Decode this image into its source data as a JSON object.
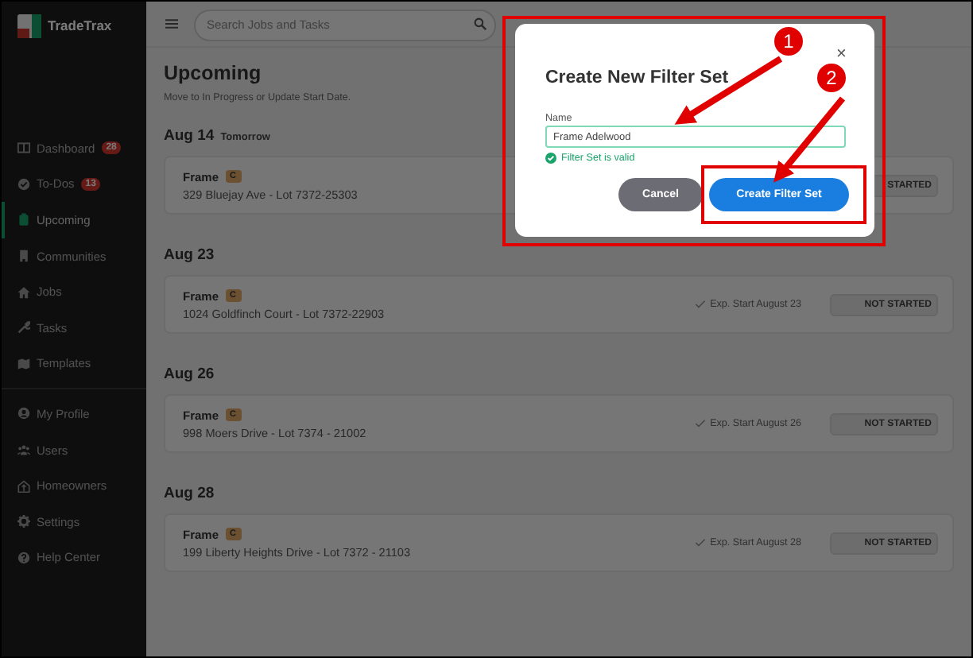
{
  "app": {
    "logo": "TradeTrax"
  },
  "sidebar": {
    "groups": [
      [
        {
          "label": "Dashboard",
          "badge": "28",
          "selected": false
        },
        {
          "label": "To-Dos",
          "badge": "13",
          "selected": false
        },
        {
          "label": "Upcoming",
          "selected": true
        },
        {
          "label": "Communities",
          "selected": false
        },
        {
          "label": "Jobs",
          "selected": false
        },
        {
          "label": "Tasks",
          "selected": false
        },
        {
          "label": "Templates",
          "selected": false
        }
      ],
      [
        {
          "label": "My Profile",
          "selected": false
        },
        {
          "label": "Users",
          "selected": false
        },
        {
          "label": "Homeowners",
          "selected": false
        },
        {
          "label": "Settings",
          "selected": false
        },
        {
          "label": "Help Center",
          "selected": false
        }
      ]
    ]
  },
  "header": {
    "search": {
      "placeholder": "Search Jobs and Tasks"
    }
  },
  "page": {
    "title": "Upcoming",
    "subtitle": "Move to In Progress or Update Start Date.",
    "sections": [
      {
        "date": "Aug 14",
        "note": "Tomorrow",
        "tasks": [
          {
            "name": "Frame",
            "tag": "C",
            "address": "329 Bluejay Ave - Lot 7372-25303",
            "status": "STARTED"
          }
        ]
      },
      {
        "date": "Aug 23",
        "tasks": [
          {
            "name": "Frame",
            "tag": "C",
            "address": "1024 Goldfinch Court - Lot 7372-22903",
            "expected": "Exp. Start August 23",
            "status": "NOT STARTED"
          }
        ]
      },
      {
        "date": "Aug 26",
        "tasks": [
          {
            "name": "Frame",
            "tag": "C",
            "address": "998 Moers Drive - Lot 7374 - 21002",
            "expected": "Exp. Start August 26",
            "status": "NOT STARTED"
          }
        ]
      },
      {
        "date": "Aug 28",
        "tasks": [
          {
            "name": "Frame",
            "tag": "C",
            "address": "199 Liberty Heights Drive - Lot 7372 - 21103",
            "expected": "Exp. Start August 28",
            "status": "NOT STARTED"
          }
        ]
      }
    ]
  },
  "modal": {
    "title": "Create New Filter Set",
    "close": "×",
    "field": {
      "label": "Name",
      "value": "Frame Adelwood",
      "valid": true,
      "message": "Filter Set is valid"
    },
    "buttons": [
      {
        "label": "Cancel",
        "kind": "secondary"
      },
      {
        "label": "Create Filter Set",
        "kind": "primary"
      }
    ]
  },
  "annotations": {
    "callouts": [
      "1",
      "2"
    ]
  }
}
